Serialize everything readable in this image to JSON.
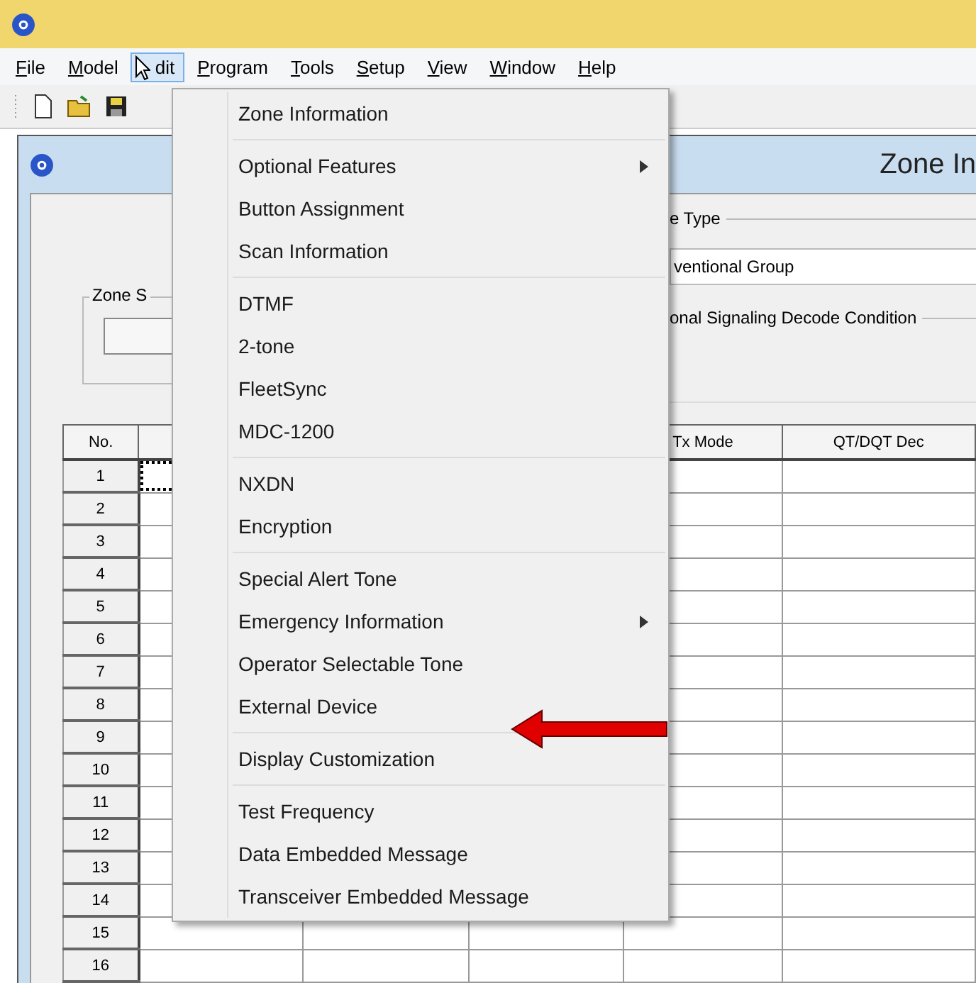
{
  "menu_bar": {
    "items": [
      {
        "label": "File",
        "selected": false
      },
      {
        "label": "Model",
        "selected": false
      },
      {
        "label": "dit",
        "selected": true,
        "cursor": true
      },
      {
        "label": "Program",
        "selected": false
      },
      {
        "label": "Tools",
        "selected": false
      },
      {
        "label": "Setup",
        "selected": false
      },
      {
        "label": "View",
        "selected": false
      },
      {
        "label": "Window",
        "selected": false
      },
      {
        "label": "Help",
        "selected": false
      }
    ]
  },
  "edit_menu": {
    "items": [
      {
        "kind": "item",
        "label": "Zone Information",
        "submenu": false
      },
      {
        "kind": "separator"
      },
      {
        "kind": "item",
        "label": "Optional Features",
        "submenu": true
      },
      {
        "kind": "item",
        "label": "Button Assignment",
        "submenu": false
      },
      {
        "kind": "item",
        "label": "Scan Information",
        "submenu": false
      },
      {
        "kind": "separator"
      },
      {
        "kind": "item",
        "label": "DTMF",
        "submenu": false
      },
      {
        "kind": "item",
        "label": "2-tone",
        "submenu": false
      },
      {
        "kind": "item",
        "label": "FleetSync",
        "submenu": false
      },
      {
        "kind": "item",
        "label": "MDC-1200",
        "submenu": false
      },
      {
        "kind": "separator"
      },
      {
        "kind": "item",
        "label": "NXDN",
        "submenu": false
      },
      {
        "kind": "item",
        "label": "Encryption",
        "submenu": false
      },
      {
        "kind": "separator"
      },
      {
        "kind": "item",
        "label": "Special Alert Tone",
        "submenu": false
      },
      {
        "kind": "item",
        "label": "Emergency Information",
        "submenu": true
      },
      {
        "kind": "item",
        "label": "Operator Selectable Tone",
        "submenu": false
      },
      {
        "kind": "item",
        "label": "External Device",
        "submenu": false,
        "arrow": true
      },
      {
        "kind": "separator"
      },
      {
        "kind": "item",
        "label": "Display Customization",
        "submenu": false
      },
      {
        "kind": "separator"
      },
      {
        "kind": "item",
        "label": "Test Frequency",
        "submenu": false
      },
      {
        "kind": "item",
        "label": "Data Embedded Message",
        "submenu": false
      },
      {
        "kind": "item",
        "label": "Transceiver Embedded Message",
        "submenu": false
      }
    ]
  },
  "child_window": {
    "title": "Zone In",
    "zone_group_label": "Zone S",
    "type_group_label": "e Type",
    "type_value": "ventional Group",
    "signaling_group_label": "onal Signaling Decode Condition"
  },
  "table": {
    "columns": [
      {
        "header": "No."
      },
      {},
      {},
      {},
      {
        "header": "Tx Mode"
      },
      {
        "header": "QT/DQT Dec"
      }
    ],
    "rows": [
      {
        "no": "1",
        "focused": true
      },
      {
        "no": "2",
        "focused": false
      },
      {
        "no": "3",
        "focused": false
      },
      {
        "no": "4",
        "focused": false
      },
      {
        "no": "5",
        "focused": false
      },
      {
        "no": "6",
        "focused": false
      },
      {
        "no": "7",
        "focused": false
      },
      {
        "no": "8",
        "focused": false
      },
      {
        "no": "9",
        "focused": false
      },
      {
        "no": "10",
        "focused": false
      },
      {
        "no": "11",
        "focused": false
      },
      {
        "no": "12",
        "focused": false
      },
      {
        "no": "13",
        "focused": false
      },
      {
        "no": "14",
        "focused": false
      },
      {
        "no": "15",
        "focused": false
      },
      {
        "no": "16",
        "focused": false
      }
    ]
  }
}
